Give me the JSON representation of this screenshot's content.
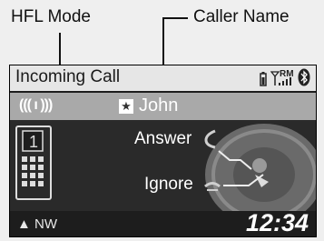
{
  "callouts": {
    "hfl_mode": "HFL Mode",
    "caller_name": "Caller Name"
  },
  "status": {
    "title": "Incoming Call",
    "rm_label": "RM"
  },
  "caller": {
    "name": "John"
  },
  "options": {
    "answer": "Answer",
    "ignore": "Ignore"
  },
  "footer": {
    "heading": "NW",
    "time": "12:34"
  },
  "icons": {
    "phone": "mobile-phone-icon",
    "ring": "ringing-signal-icon",
    "star": "favorite-star-icon",
    "bluetooth": "bluetooth-icon",
    "signal": "signal-strength-icon",
    "battery": "battery-icon",
    "answer": "answer-handset-icon",
    "ignore": "ignore-handset-icon",
    "dial": "interface-dial-icon",
    "compass": "compass-arrow-icon"
  }
}
